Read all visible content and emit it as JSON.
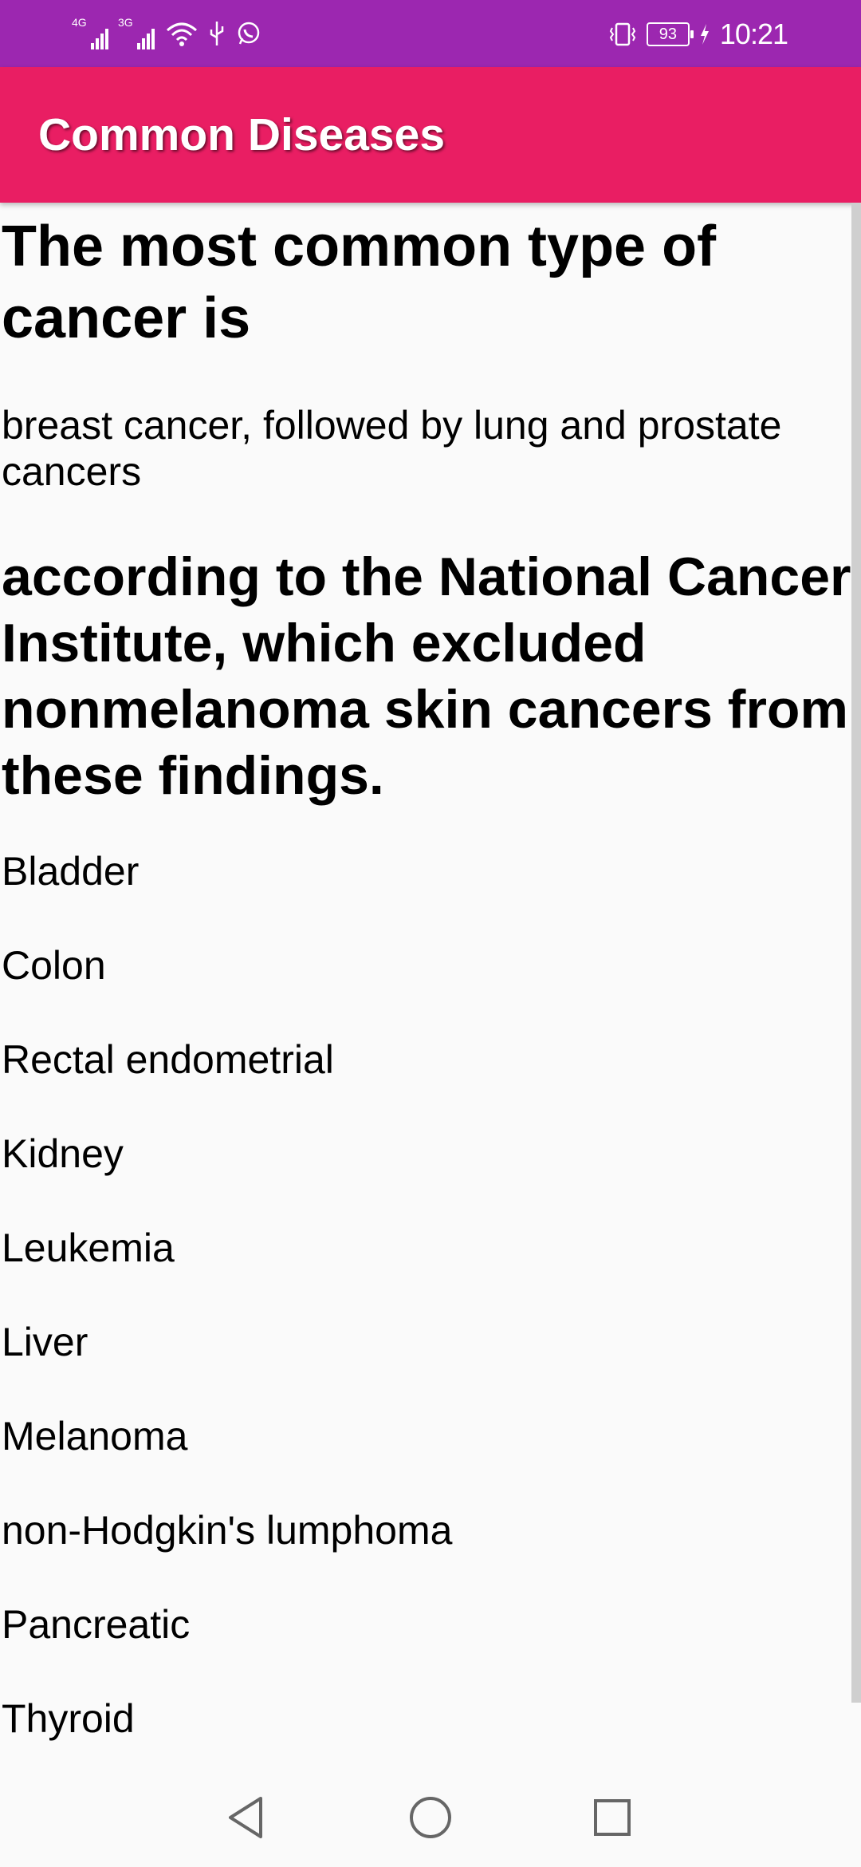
{
  "status_bar": {
    "network_1": "4G",
    "network_2": "3G",
    "battery_level": "93",
    "time": "10:21",
    "icons": [
      "signal-icon",
      "signal-icon",
      "wifi-icon",
      "usb-icon",
      "whatsapp-icon",
      "vibrate-icon",
      "battery-icon",
      "charging-icon"
    ]
  },
  "app_bar": {
    "title": "Common Diseases",
    "color": "#e91e63"
  },
  "content": {
    "heading": "The most common type of cancer is",
    "answer": "breast cancer, followed by lung and prostate cancers",
    "subheading": "according to the National Cancer Institute, which excluded nonmelanoma skin cancers from these findings.",
    "diseases": [
      "Bladder",
      "Colon",
      "Rectal endometrial",
      "Kidney",
      "Leukemia",
      "Liver",
      "Melanoma",
      "non-Hodgkin's lumphoma",
      "Pancreatic",
      "Thyroid"
    ]
  },
  "nav_bar": {
    "icons": [
      "back-icon",
      "home-icon",
      "recents-icon"
    ]
  },
  "colors": {
    "status_bar": "#9c27b0",
    "app_bar": "#e91e63",
    "background": "#fafafa"
  }
}
